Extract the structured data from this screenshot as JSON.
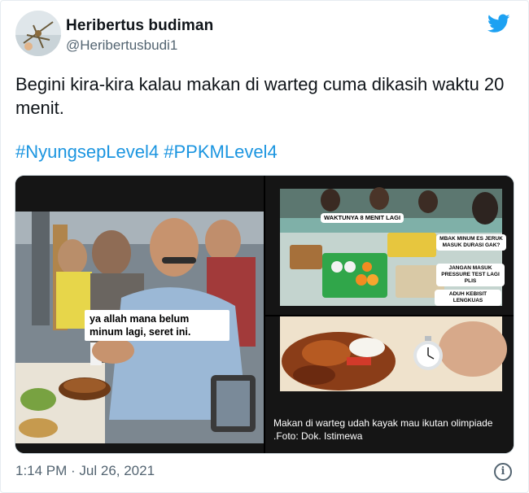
{
  "author": {
    "name": "Heribertus budiman",
    "handle": "@Heribertusbudi1"
  },
  "tweet": {
    "text": "Begini kira-kira kalau makan di warteg cuma dikasih waktu 20 menit.",
    "hashtags": [
      "#NyungsepLevel4",
      "#PPKMLevel4"
    ]
  },
  "media": {
    "left_caption": "ya allah mana belum minum lagi, seret ini.",
    "top_right_labels": [
      "WAKTUNYA 8 MENIT LAGI",
      "MBAK MINUM ES JERUK MASUK DURASI GAK?",
      "JANGAN MASUK PRESSURE TEST LAGI PLIS",
      "ADUH KEBISIT LENGKUAS"
    ],
    "bottom_caption": "Makan di warteg udah kayak mau ikutan olimpiade .Foto: Dok. Istimewa"
  },
  "footer": {
    "timestamp": "1:14 PM · Jul 26, 2021"
  },
  "icons": {
    "bird": "twitter-bird-icon",
    "info": "info-icon"
  },
  "colors": {
    "link": "#1b95e0",
    "secondary_text": "#536471",
    "brand": "#1da1f2"
  }
}
